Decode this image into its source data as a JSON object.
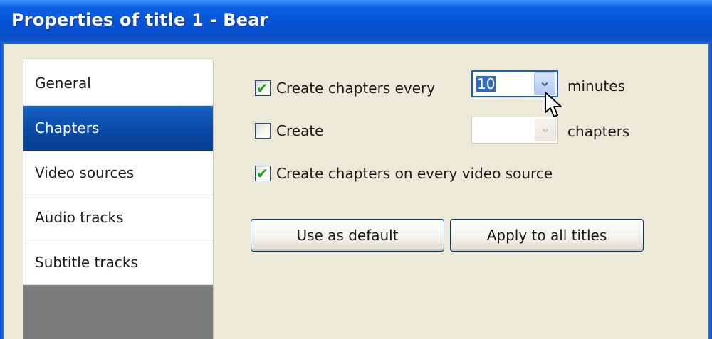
{
  "window": {
    "title": "Properties of title 1 - Bear"
  },
  "sidebar": {
    "items": [
      {
        "label": "General"
      },
      {
        "label": "Chapters",
        "selected": true
      },
      {
        "label": "Video sources"
      },
      {
        "label": "Audio tracks"
      },
      {
        "label": "Subtitle tracks"
      }
    ]
  },
  "chapters": {
    "every_minutes": {
      "checked": true,
      "label": "Create chapters every",
      "value": "10",
      "suffix": "minutes"
    },
    "count": {
      "checked": false,
      "label": "Create",
      "value": "",
      "suffix": "chapters"
    },
    "every_source": {
      "checked": true,
      "label": "Create chapters on every video source"
    },
    "buttons": {
      "use_default": "Use as default",
      "apply_all": "Apply to all titles"
    }
  },
  "icons": {
    "check": "✔",
    "dropdown": "⌄"
  },
  "colors": {
    "titlebar": "#0753d6",
    "selected_nav": "#0a4aa8",
    "check_green": "#21a121"
  }
}
